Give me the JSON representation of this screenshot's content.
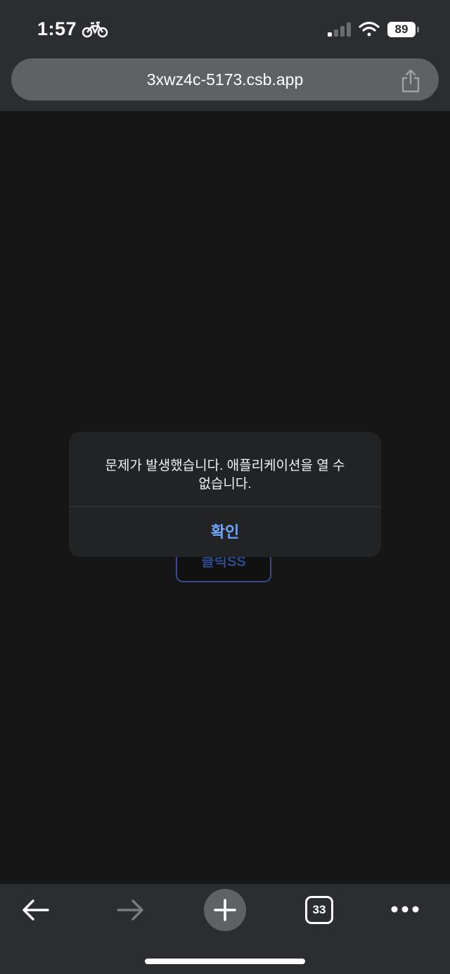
{
  "status_bar": {
    "time": "1:57",
    "battery": "89",
    "icons": [
      "bike-icon",
      "signal-icon",
      "wifi-icon",
      "battery-icon"
    ]
  },
  "browser": {
    "url": "3xwz4c-5173.csb.app",
    "tab_count": "33",
    "icons": [
      "share-icon",
      "back-icon",
      "forward-icon",
      "plus-icon",
      "more-icon"
    ]
  },
  "page": {
    "button_label": "클릭SS"
  },
  "alert": {
    "message": "문제가 발생했습니다. 애플리케이션을 열 수 없습니다.",
    "confirm_label": "확인"
  },
  "colors": {
    "chrome_bg": "#2b2d30",
    "page_bg": "#161616",
    "alert_bg": "#222325",
    "link_blue": "#6ea6ff"
  }
}
